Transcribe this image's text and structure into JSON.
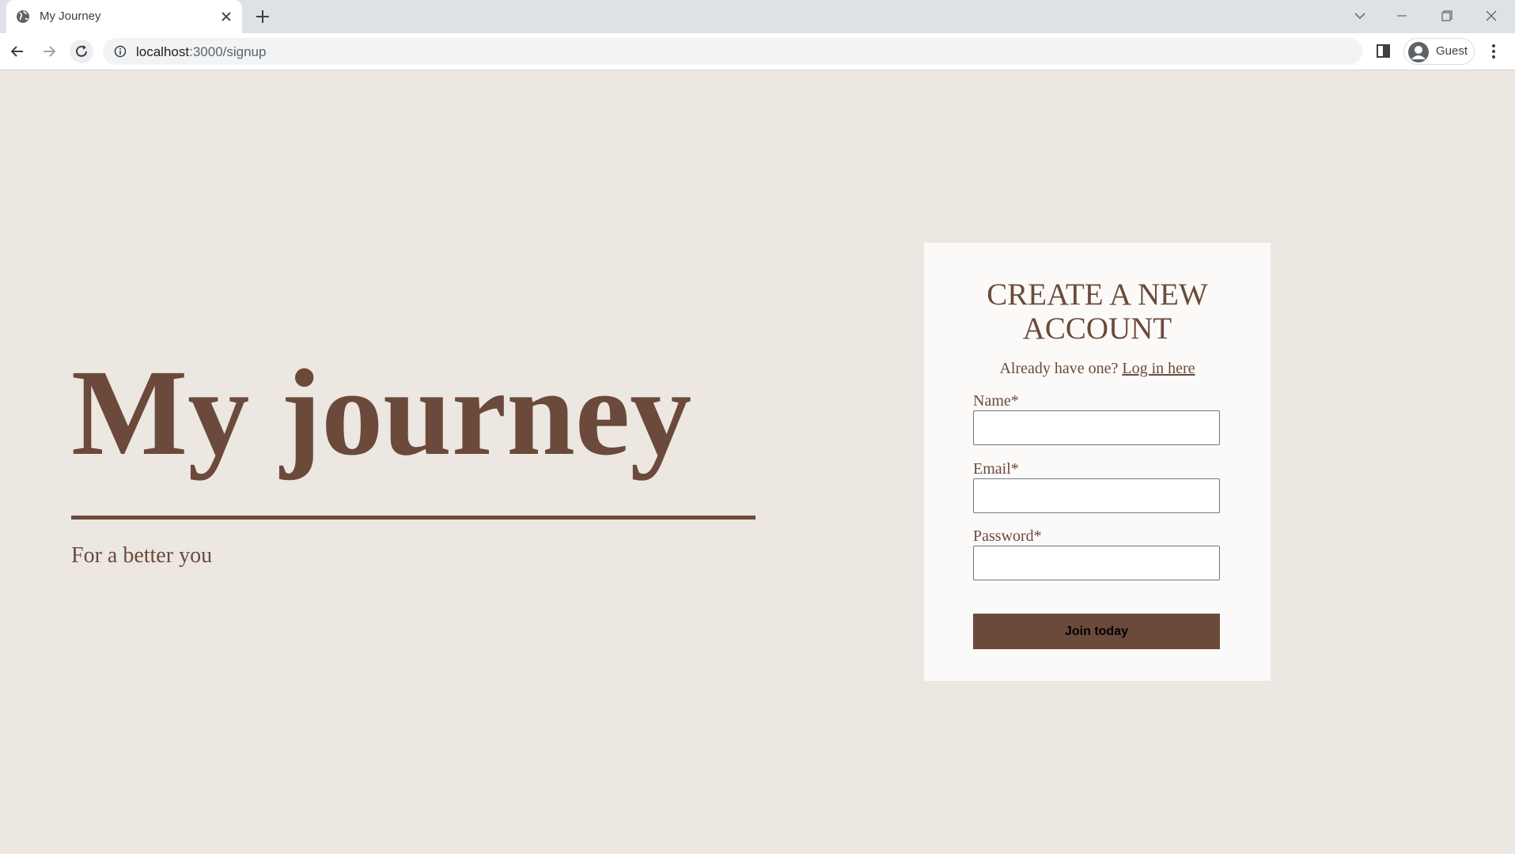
{
  "browser": {
    "tab_title": "My Journey",
    "new_tab_label": "+",
    "url_host": "localhost",
    "url_path": ":3000/signup",
    "profile_label": "Guest"
  },
  "hero": {
    "title": "My journey",
    "subtitle": "For a better you"
  },
  "signup": {
    "title_line1": "CREATE A NEW",
    "title_line2": "ACCOUNT",
    "login_prompt": "Already have one?",
    "login_link": "Log in here",
    "name_label": "Name*",
    "email_label": "Email*",
    "password_label": "Password*",
    "submit_label": "Join today"
  },
  "colors": {
    "brand_brown": "#6b4a3b",
    "page_background": "#ece7e1",
    "card_background": "#fbfaf8"
  }
}
